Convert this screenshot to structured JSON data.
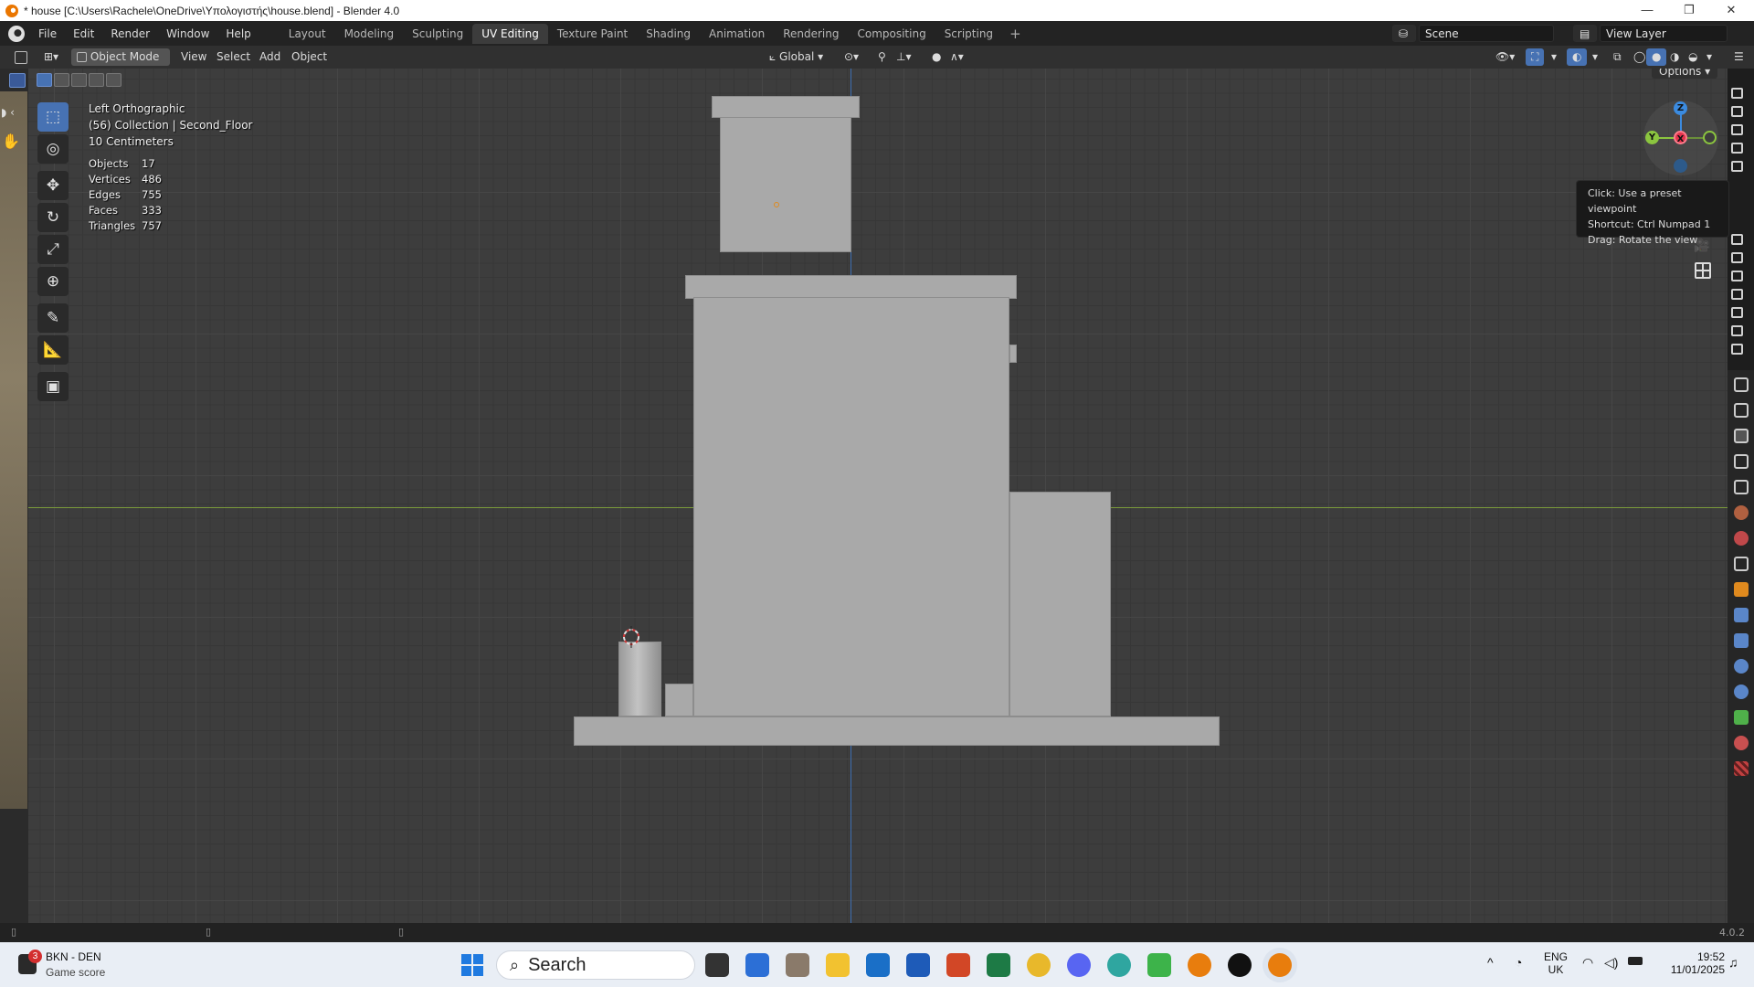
{
  "window": {
    "title": "* house [C:\\Users\\Rachele\\OneDrive\\Υπολογιστής\\house.blend] - Blender 4.0",
    "minimize": "—",
    "maximize": "❐",
    "close": "✕"
  },
  "menu": [
    "File",
    "Edit",
    "Render",
    "Window",
    "Help"
  ],
  "workspaces": [
    {
      "label": "Layout",
      "active": false
    },
    {
      "label": "Modeling",
      "active": false
    },
    {
      "label": "Sculpting",
      "active": false
    },
    {
      "label": "UV Editing",
      "active": true
    },
    {
      "label": "Texture Paint",
      "active": false
    },
    {
      "label": "Shading",
      "active": false
    },
    {
      "label": "Animation",
      "active": false
    },
    {
      "label": "Rendering",
      "active": false
    },
    {
      "label": "Compositing",
      "active": false
    },
    {
      "label": "Scripting",
      "active": false
    }
  ],
  "workspace_add": "+",
  "scene": {
    "name": "Scene",
    "view_layer": "View Layer"
  },
  "viewport_header": {
    "mode": "Object Mode",
    "view": "View",
    "select": "Select",
    "add": "Add",
    "object": "Object",
    "orientation": "Global",
    "options": "Options"
  },
  "overlay_info": {
    "view_name": "Left Orthographic",
    "collection": "(56) Collection | Second_Floor",
    "grid_scale": "10 Centimeters"
  },
  "stats": [
    {
      "label": "Objects",
      "value": "17"
    },
    {
      "label": "Vertices",
      "value": "486"
    },
    {
      "label": "Edges",
      "value": "755"
    },
    {
      "label": "Faces",
      "value": "333"
    },
    {
      "label": "Triangles",
      "value": "757"
    }
  ],
  "gizmo": {
    "z": "Z",
    "y": "Y",
    "x": "X"
  },
  "tooltip": {
    "line1": "Click: Use a preset viewpoint",
    "line2": "Shortcut: Ctrl Numpad 1",
    "line3": "Drag: Rotate the view"
  },
  "status_bar": {
    "version": "4.0.2"
  },
  "taskbar": {
    "notification_count": "3",
    "widget_title": "BKN - DEN",
    "widget_subtitle": "Game score",
    "search_placeholder": "Search",
    "lang_top": "ENG",
    "lang_bottom": "UK",
    "time": "19:52",
    "date": "11/01/2025"
  },
  "colors": {
    "accent": "#4772b3",
    "x_axis": "#e2344d",
    "y_axis": "#8bc53f",
    "z_axis": "#3b8be0"
  }
}
